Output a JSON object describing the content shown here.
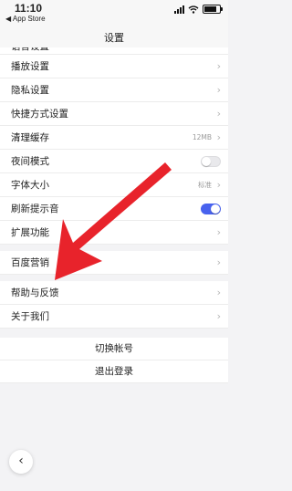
{
  "status_bar": {
    "time": "11:10",
    "back_app": "◀ App Store"
  },
  "nav": {
    "title": "设置"
  },
  "rows": {
    "partial": "语音设置",
    "playback": "播放设置",
    "privacy": "隐私设置",
    "shortcut": "快捷方式设置",
    "cache": {
      "label": "清理缓存",
      "value": "12MB"
    },
    "night": {
      "label": "夜间模式",
      "on": false
    },
    "font": {
      "label": "字体大小",
      "value": "标准"
    },
    "refresh_sound": {
      "label": "刷新提示音",
      "on": true
    },
    "extensions": "扩展功能",
    "marketing": "百度营销",
    "help": "帮助与反馈",
    "about": "关于我们"
  },
  "actions": {
    "switch_account": "切换帐号",
    "logout": "退出登录"
  },
  "colors": {
    "accent": "#4862ee",
    "arrow": "#e8232b"
  }
}
